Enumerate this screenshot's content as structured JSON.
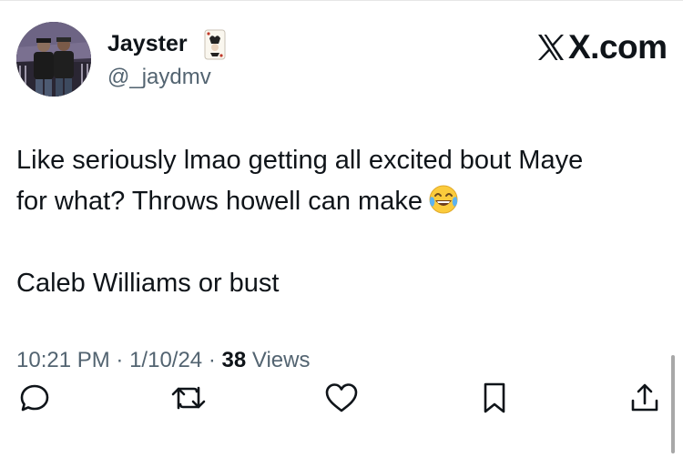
{
  "brand": {
    "text": "X.com",
    "icon": "x-logo-icon"
  },
  "author": {
    "display_name": "Jayster",
    "handle": "@_jaydmv",
    "avatar": "avatar-photo",
    "badge_icon": "playing-card-emoji-icon"
  },
  "tweet": {
    "lines": [
      "Like seriously lmao getting all excited bout Maye",
      "for what? Throws howell can make",
      "Caleb Williams or bust"
    ],
    "emoji_icon": "face-with-tears-of-joy-emoji"
  },
  "meta": {
    "time": "10:21 PM",
    "separator": "·",
    "date": "1/10/24",
    "views_count": "38",
    "views_label": "Views"
  },
  "actions": {
    "reply_icon": "reply-icon",
    "repost_icon": "repost-icon",
    "like_icon": "heart-icon",
    "bookmark_icon": "bookmark-icon",
    "share_icon": "share-icon"
  },
  "colors": {
    "text": "#0f1419",
    "secondary": "#536471",
    "background": "#ffffff"
  }
}
